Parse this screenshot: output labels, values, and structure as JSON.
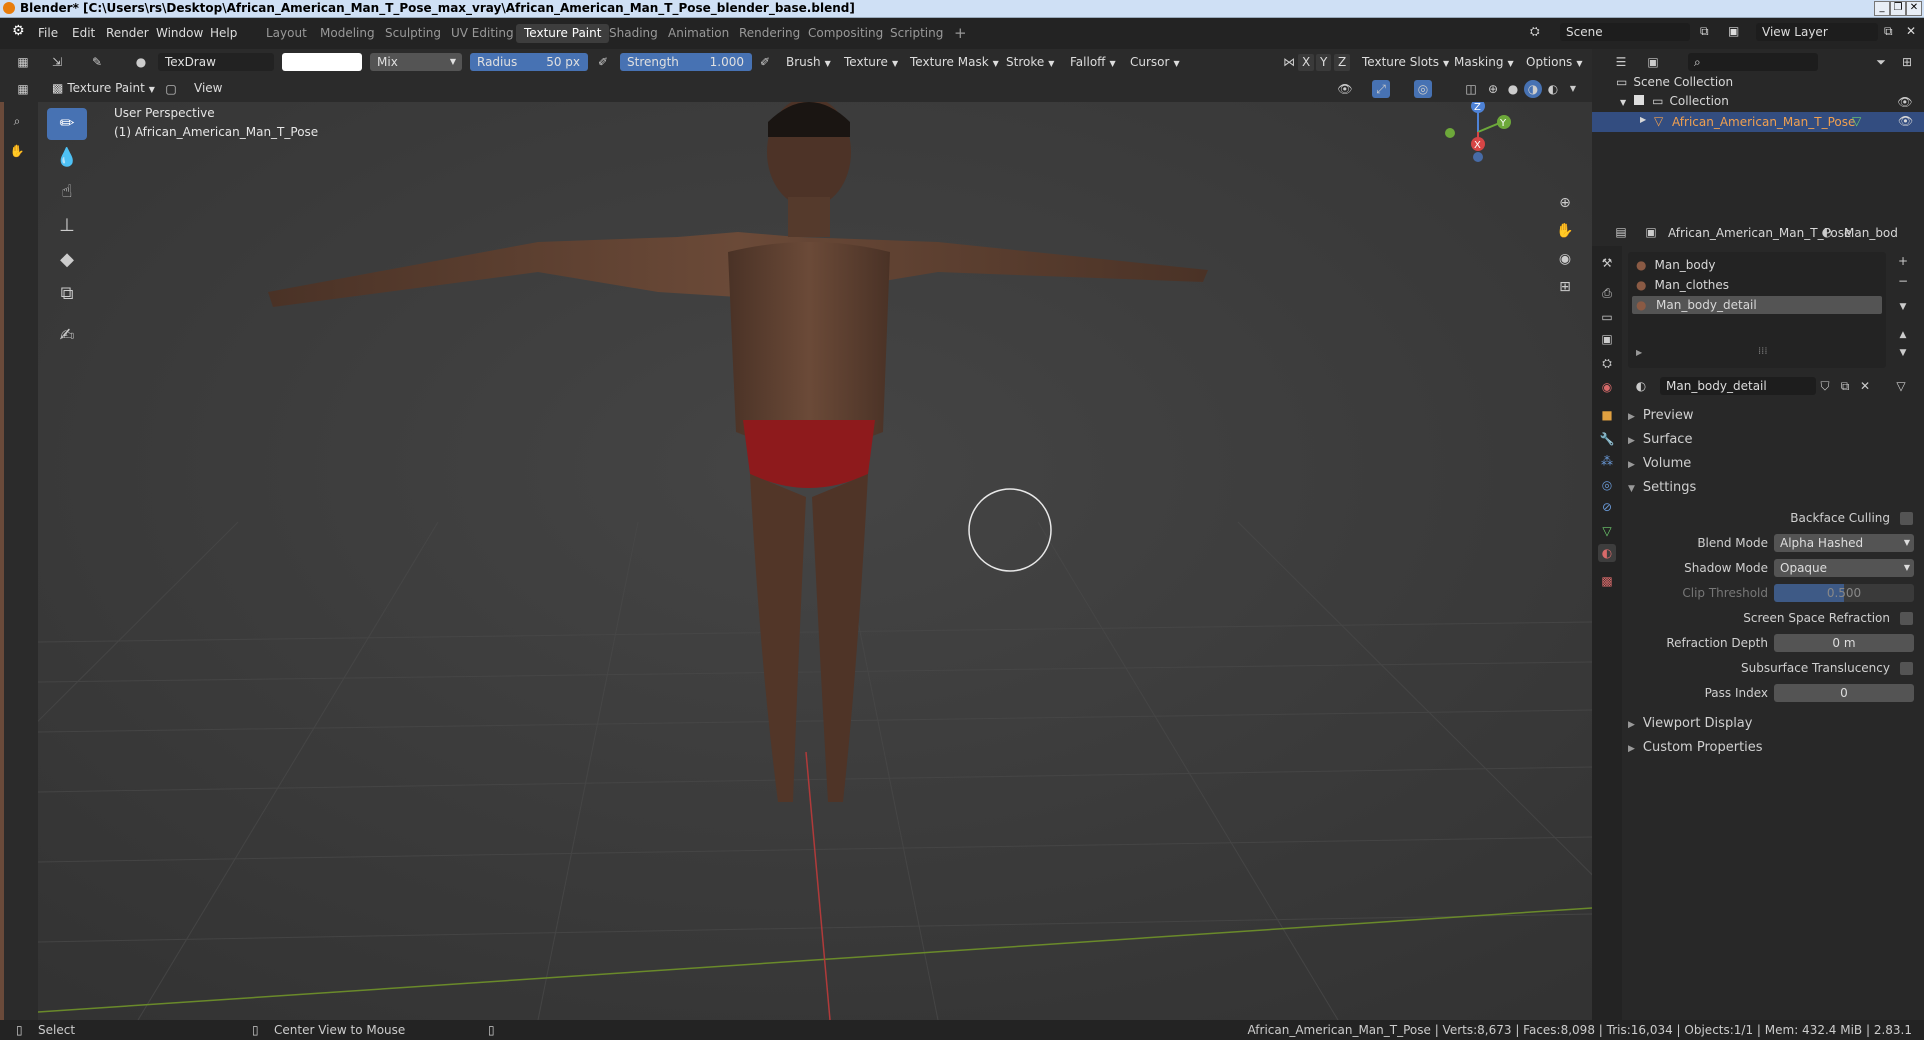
{
  "window": {
    "title": "Blender* [C:\\Users\\rs\\Desktop\\African_American_Man_T_Pose_max_vray\\African_American_Man_T_Pose_blender_base.blend]"
  },
  "menu": [
    "File",
    "Edit",
    "Render",
    "Window",
    "Help"
  ],
  "workspaces": [
    "Layout",
    "Modeling",
    "Sculpting",
    "UV Editing",
    "Texture Paint",
    "Shading",
    "Animation",
    "Rendering",
    "Compositing",
    "Scripting"
  ],
  "workspace_add": "+",
  "scene": {
    "name": "Scene",
    "view_layer": "View Layer"
  },
  "toolheader": {
    "brush_name": "TexDraw",
    "blend": "Mix",
    "radius_label": "Radius",
    "radius_value": "50 px",
    "strength_label": "Strength",
    "strength_value": "1.000",
    "dropdowns": [
      "Brush",
      "Texture",
      "Texture Mask",
      "Stroke",
      "Falloff",
      "Cursor"
    ],
    "axes": [
      "X",
      "Y",
      "Z"
    ],
    "right_dropdowns": [
      "Texture Slots",
      "Masking",
      "Options"
    ]
  },
  "viewheader": {
    "mode": "Texture Paint",
    "view": "View"
  },
  "viewport": {
    "perspective": "User Perspective",
    "object_label": "(1) African_American_Man_T_Pose",
    "gizmo": {
      "x": "X",
      "y": "Y",
      "z": "Z"
    }
  },
  "outliner": {
    "scene_collection": "Scene Collection",
    "collection": "Collection",
    "object": "African_American_Man_T_Pose"
  },
  "properties": {
    "object_name": "African_American_Man_T_Pose",
    "material_tab": "Man_bod",
    "material_slots": [
      "Man_body",
      "Man_clothes",
      "Man_body_detail"
    ],
    "selected_slot": 2,
    "material_name": "Man_body_detail",
    "panels_collapsed": [
      "Preview",
      "Surface",
      "Volume"
    ],
    "settings_header": "Settings",
    "settings": {
      "backface_culling_label": "Backface Culling",
      "blend_mode_label": "Blend Mode",
      "blend_mode_value": "Alpha Hashed",
      "shadow_mode_label": "Shadow Mode",
      "shadow_mode_value": "Opaque",
      "clip_threshold_label": "Clip Threshold",
      "clip_threshold_value": "0.500",
      "ssr_label": "Screen Space Refraction",
      "refraction_depth_label": "Refraction Depth",
      "refraction_depth_value": "0 m",
      "subsurface_label": "Subsurface Translucency",
      "pass_index_label": "Pass Index",
      "pass_index_value": "0"
    },
    "panels_after": [
      "Viewport Display",
      "Custom Properties"
    ]
  },
  "statusbar": {
    "select": "Select",
    "center_view": "Center View to Mouse",
    "stats": "African_American_Man_T_Pose | Verts:8,673 | Faces:8,098 | Tris:16,034 | Objects:1/1 | Mem: 432.4 MiB | 2.83.1"
  },
  "colors": {
    "accent": "#4772b3",
    "header": "#2b2b2b",
    "panel": "#282828",
    "viewport": "#3b3b3b",
    "selected_object": "#f0a050"
  }
}
